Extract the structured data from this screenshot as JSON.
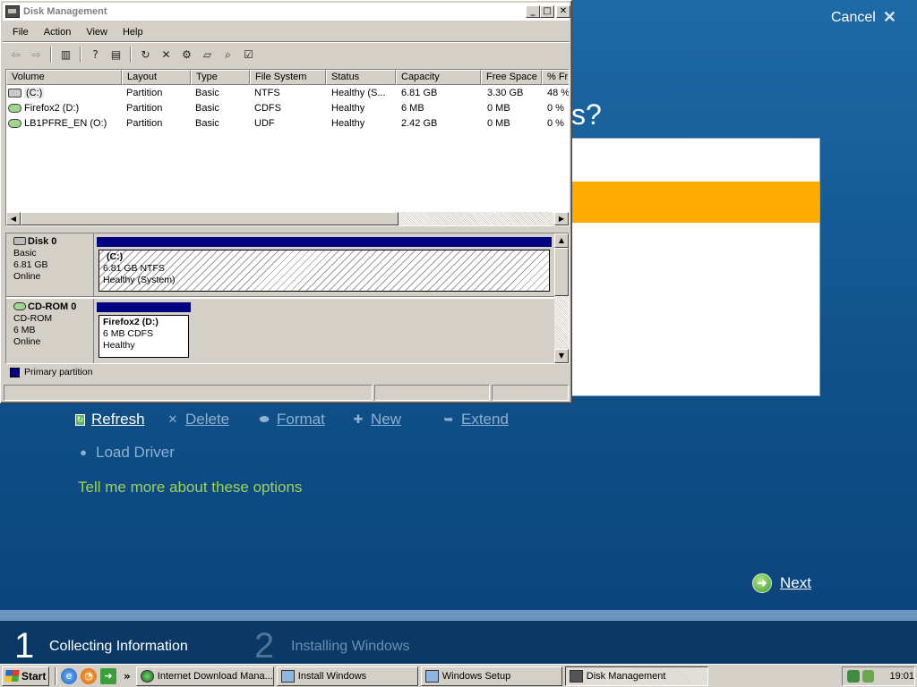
{
  "setup": {
    "cancel_label": "Cancel",
    "heading_fragment": "s?",
    "actions": {
      "refresh": "Refresh",
      "delete": "Delete",
      "format": "Format",
      "new": "New",
      "extend": "Extend",
      "load_driver": "Load Driver"
    },
    "tell_more_link": "Tell me more about these options",
    "next_label": "Next",
    "steps": [
      {
        "number": "1",
        "label": "Collecting Information"
      },
      {
        "number": "2",
        "label": "Installing Windows"
      }
    ],
    "colors": {
      "selection": "#ffab00",
      "link": "#9ed15a",
      "background": "#155d98"
    }
  },
  "disk_management": {
    "title": "Disk Management",
    "menu": [
      "File",
      "Action",
      "View",
      "Help"
    ],
    "columns": [
      "Volume",
      "Layout",
      "Type",
      "File System",
      "Status",
      "Capacity",
      "Free Space",
      "% Fr"
    ],
    "volumes": [
      {
        "name": "(C:)",
        "layout": "Partition",
        "type": "Basic",
        "fs": "NTFS",
        "status": "Healthy (S...",
        "capacity": "6.81 GB",
        "free": "3.30 GB",
        "pct": "48 %",
        "icon": "hard-disk-icon"
      },
      {
        "name": "Firefox2 (D:)",
        "layout": "Partition",
        "type": "Basic",
        "fs": "CDFS",
        "status": "Healthy",
        "capacity": "6 MB",
        "free": "0 MB",
        "pct": "0 %",
        "icon": "cd-drive-icon"
      },
      {
        "name": "LB1PFRE_EN (O:)",
        "layout": "Partition",
        "type": "Basic",
        "fs": "UDF",
        "status": "Healthy",
        "capacity": "2.42 GB",
        "free": "0 MB",
        "pct": "0 %",
        "icon": "cd-drive-icon"
      }
    ],
    "disks": [
      {
        "name": "Disk 0",
        "kind": "Basic",
        "size": "6.81 GB",
        "state": "Online",
        "partition": {
          "label": "(C:)",
          "detail": "6.81 GB NTFS",
          "status": "Healthy (System)"
        }
      },
      {
        "name": "CD-ROM 0",
        "kind": "CD-ROM",
        "size": "6 MB",
        "state": "Online",
        "partition": {
          "label": "Firefox2  (D:)",
          "detail": "6 MB CDFS",
          "status": "Healthy"
        }
      }
    ],
    "legend": "Primary partition",
    "colors": {
      "primary_partition": "#000080"
    }
  },
  "taskbar": {
    "start_label": "Start",
    "more": "»",
    "tasks": [
      "Internet Download Mana...",
      "Install Windows",
      "Windows Setup",
      "Disk Management"
    ],
    "active_task": "Disk Management",
    "clock": "19:01"
  }
}
